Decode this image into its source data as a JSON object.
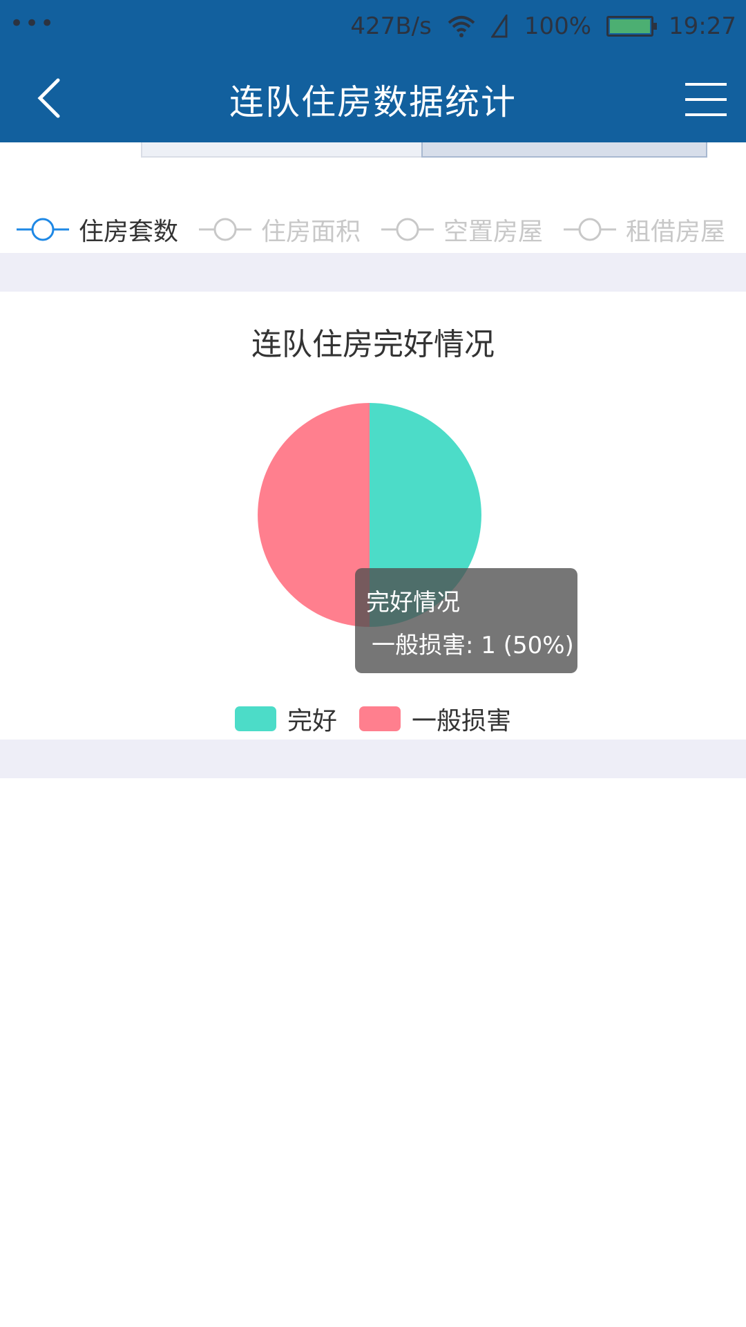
{
  "status_bar": {
    "dots": "•••",
    "network_speed": "427B/s",
    "battery_percent": "100%",
    "time": "19:27"
  },
  "header": {
    "title": "连队住房数据统计",
    "back_icon": "chevron-left-icon",
    "menu_icon": "hamburger-menu-icon"
  },
  "series_tabs": [
    {
      "label": "住房套数",
      "active": true
    },
    {
      "label": "住房面积",
      "active": false
    },
    {
      "label": "空置房屋",
      "active": false
    },
    {
      "label": "租借房屋",
      "active": false
    }
  ],
  "colors": {
    "primary": "#12609e",
    "active_tab": "#1e88e5",
    "inactive_tab": "#c8c8c8",
    "good": "#4cdcc8",
    "damaged": "#ff7f8e"
  },
  "chart_data": {
    "type": "pie",
    "title": "连队住房完好情况",
    "categories": [
      "完好",
      "一般损害"
    ],
    "values": [
      1,
      1
    ],
    "tooltip": {
      "title": "完好情况",
      "body": "一般损害: 1 (50%)"
    }
  }
}
